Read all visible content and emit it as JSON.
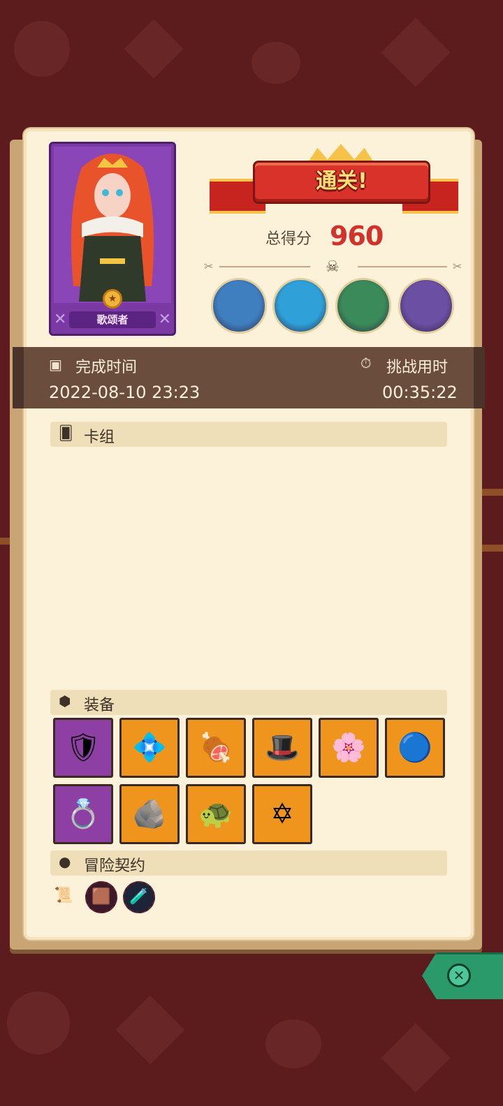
{
  "result": {
    "banner_text": "通关!",
    "score_label": "总得分",
    "score_value": "960"
  },
  "hero": {
    "name": "歌颂者",
    "card_color": "#7b3aa3"
  },
  "bosses": [
    {
      "icon": "mushroom-elder-boss-icon",
      "color": "#3f7fbf"
    },
    {
      "icon": "crowned-skull-boss-icon",
      "color": "#2fa0d8"
    },
    {
      "icon": "serpent-boss-icon",
      "color": "#3a8a5a"
    },
    {
      "icon": "dragon-boss-icon",
      "color": "#6a4fa3"
    }
  ],
  "time_info": {
    "completion_label": "完成时间",
    "completion_value": "2022-08-10 23:23",
    "challenge_label": "挑战用时",
    "challenge_value": "00:35:22"
  },
  "sections": {
    "deck_title": "卡组",
    "equipment_title": "装备",
    "contract_title": "冒险契约"
  },
  "equipment": [
    {
      "name": "lion-shield-icon",
      "rarity": "purple",
      "glyph": "🛡"
    },
    {
      "name": "ice-crest-icon",
      "rarity": "orange",
      "glyph": "💠"
    },
    {
      "name": "ham-icon",
      "rarity": "orange",
      "glyph": "🍖"
    },
    {
      "name": "wizard-hat-icon",
      "rarity": "orange",
      "glyph": "🎩"
    },
    {
      "name": "lotus-flower-icon",
      "rarity": "orange",
      "glyph": "🌸"
    },
    {
      "name": "spiked-orb-icon",
      "rarity": "orange",
      "glyph": "🔵"
    },
    {
      "name": "ruby-ring-icon",
      "rarity": "purple",
      "glyph": "💍"
    },
    {
      "name": "rune-stone-icon",
      "rarity": "orange",
      "glyph": "🪨"
    },
    {
      "name": "turtle-shell-icon",
      "rarity": "orange",
      "glyph": "🐢"
    },
    {
      "name": "hexagram-badge-icon",
      "rarity": "orange",
      "glyph": "✡"
    }
  ],
  "contracts": [
    {
      "name": "scroll-icon",
      "glyph": "📜",
      "bg": "transparent"
    },
    {
      "name": "dark-cube-icon",
      "glyph": "🟫",
      "bg": "#3a1a2a"
    },
    {
      "name": "crystal-vial-icon",
      "glyph": "🧪",
      "bg": "#1d2438"
    }
  ],
  "colors": {
    "background": "#5c1c1e",
    "parchment": "#fcf2d9",
    "time_bar": "#6b4d3d",
    "score": "#d3312c",
    "banner": "#d8322a",
    "close_button": "#2a9a6b"
  }
}
